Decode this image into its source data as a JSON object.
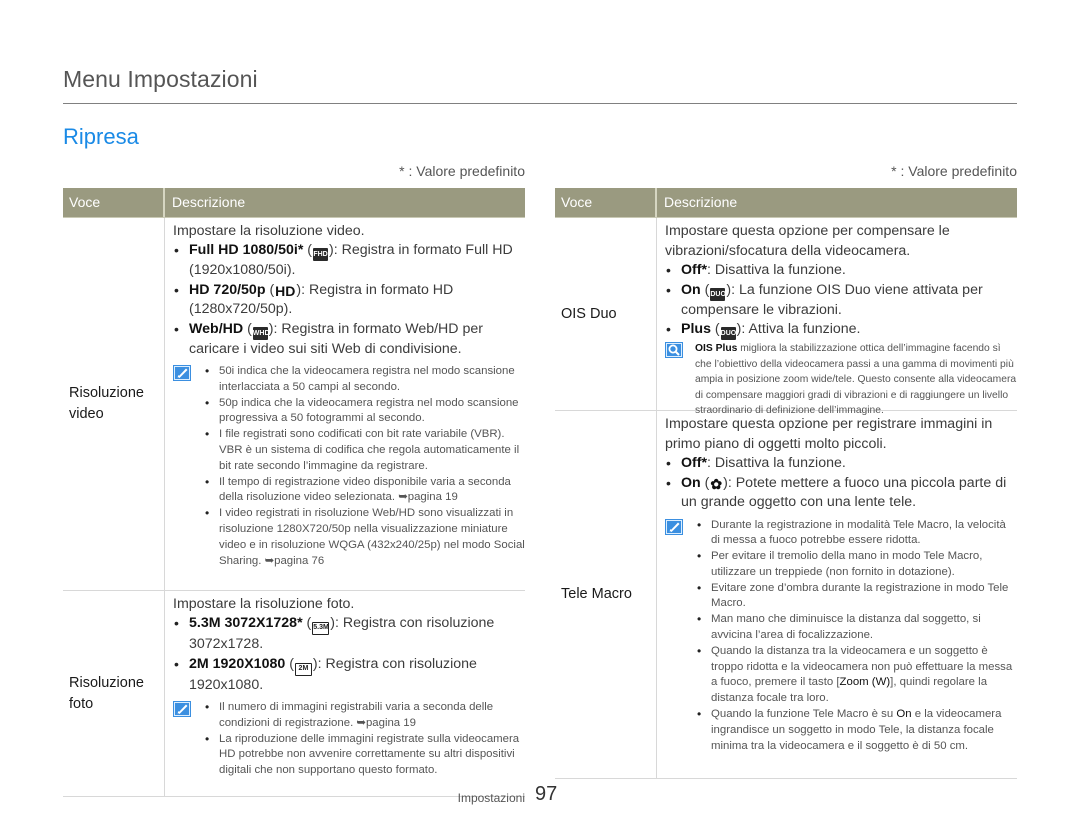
{
  "header": {
    "title": "Menu Impostazioni",
    "section": "Ripresa",
    "section_color": "#1a8ae6"
  },
  "default_note": "* : Valore predefinito",
  "table_header": {
    "voce": "Voce",
    "descrizione": "Descrizione",
    "color": "#9a9a80"
  },
  "left": {
    "rows": [
      {
        "voce": "Risoluzione video",
        "intro": "Impostare la risoluzione video.",
        "options": [
          {
            "label": "Full HD 1080/50i*",
            "icon": "full-hd-icon",
            "icon_text": "FULL HD",
            "text": "Registra in formato Full HD (1920x1080/50i)."
          },
          {
            "label": "HD 720/50p",
            "icon": "hd-icon",
            "icon_text": "HD",
            "text": "Registra in formato HD (1280x720/50p)."
          },
          {
            "label": "Web/HD",
            "icon": "web-hd-icon",
            "icon_text": "WEB HD",
            "text": "Registra in formato Web/HD per caricare i video sui siti Web di condivisione."
          }
        ],
        "note_icon": "pencil-note-icon",
        "notes": [
          "50i indica che la videocamera registra nel modo scansione interlacciata a 50 campi al secondo.",
          "50p indica che la videocamera registra nel modo scansione progressiva a 50 fotogrammi al secondo.",
          "I file registrati sono codificati con bit rate variabile (VBR). VBR è un sistema di codifica che regola automaticamente il bit rate secondo l’immagine da registrare.",
          "Il tempo di registrazione video disponibile varia a seconda della risoluzione video selezionata. ➥pagina 19",
          "I video registrati in risoluzione Web/HD sono visualizzati in risoluzione 1280X720/50p nella visualizzazione miniature video e in risoluzione WQGA (432x240/25p) nel modo Social Sharing. ➥pagina 76"
        ]
      },
      {
        "voce": "Risoluzione foto",
        "intro": "Impostare la risoluzione foto.",
        "options": [
          {
            "label": "5.3M 3072X1728*",
            "icon": "5-3m-icon",
            "icon_text": "5.3M",
            "text": "Registra con risoluzione 3072x1728."
          },
          {
            "label": "2M 1920X1080",
            "icon": "2m-icon",
            "icon_text": "2M",
            "text": "Registra con risoluzione 1920x1080."
          }
        ],
        "note_icon": "pencil-note-icon",
        "notes": [
          "Il numero di immagini registrabili varia a seconda delle condizioni di registrazione. ➥pagina 19",
          "La riproduzione delle immagini registrate sulla videocamera HD potrebbe non avvenire correttamente su altri dispositivi digitali che non supportano questo formato."
        ]
      }
    ]
  },
  "right": {
    "rows": [
      {
        "voce": "OIS Duo",
        "intro": "Impostare questa opzione per compensare le vibrazioni/sfocatura della videocamera.",
        "options": [
          {
            "label": "Off*",
            "icon": "",
            "icon_text": "",
            "text": "Disattiva la funzione."
          },
          {
            "label": "On",
            "icon": "ois-duo-icon",
            "icon_text": "DUO",
            "text": "La funzione OIS Duo viene attivata per compensare le vibrazioni."
          },
          {
            "label": "Plus",
            "icon": "ois-duo-plus-icon",
            "icon_text": "DUO+",
            "text": "Attiva la funzione."
          }
        ],
        "note_icon": "magnifier-tip-icon",
        "tip_bold": "OIS Plus",
        "tip_text": " migliora la stabilizzazione ottica dell’immagine facendo sì che l’obiettivo della videocamera passi a una gamma di movimenti più ampia in posizione zoom wide/tele. Questo consente alla videocamera di compensare maggiori gradi di vibrazioni e di raggiungere un livello straordinario di definizione dell’immagine."
      },
      {
        "voce": "Tele Macro",
        "intro": "Impostare questa opzione per registrare immagini in primo piano di oggetti molto piccoli.",
        "options": [
          {
            "label": "Off*",
            "icon": "",
            "icon_text": "",
            "text": "Disattiva la funzione."
          },
          {
            "label": "On",
            "icon": "tele-macro-flower-icon",
            "icon_text": "✿",
            "text": "Potete mettere a fuoco una piccola parte di un grande oggetto con una lente tele."
          }
        ],
        "note_icon": "pencil-note-icon",
        "notes": [
          "Durante la registrazione in modalità Tele Macro, la velocità di messa a fuoco potrebbe essere ridotta.",
          "Per evitare il tremolio della mano in modo Tele Macro, utilizzare un treppiede (non fornito in dotazione).",
          "Evitare zone d’ombra durante la registrazione in modo Tele Macro.",
          "Man mano che diminuisce la distanza dal soggetto, si avvicina l’area di focalizzazione."
        ],
        "note_zoom": {
          "before": "Quando la distanza tra la videocamera e un soggetto è troppo ridotta e la videocamera non può effettuare la messa a fuoco, premere il tasto [",
          "key": "Zoom (W)",
          "after": "], quindi regolare la distanza focale tra loro."
        },
        "note_on": {
          "before": "Quando la funzione Tele Macro è su ",
          "key": "On",
          "after": " e la videocamera ingrandisce un soggetto in modo Tele, la distanza focale minima tra la videocamera e il soggetto è di 50 cm."
        }
      }
    ]
  },
  "footer": {
    "section": "Impostazioni",
    "page": "97"
  }
}
